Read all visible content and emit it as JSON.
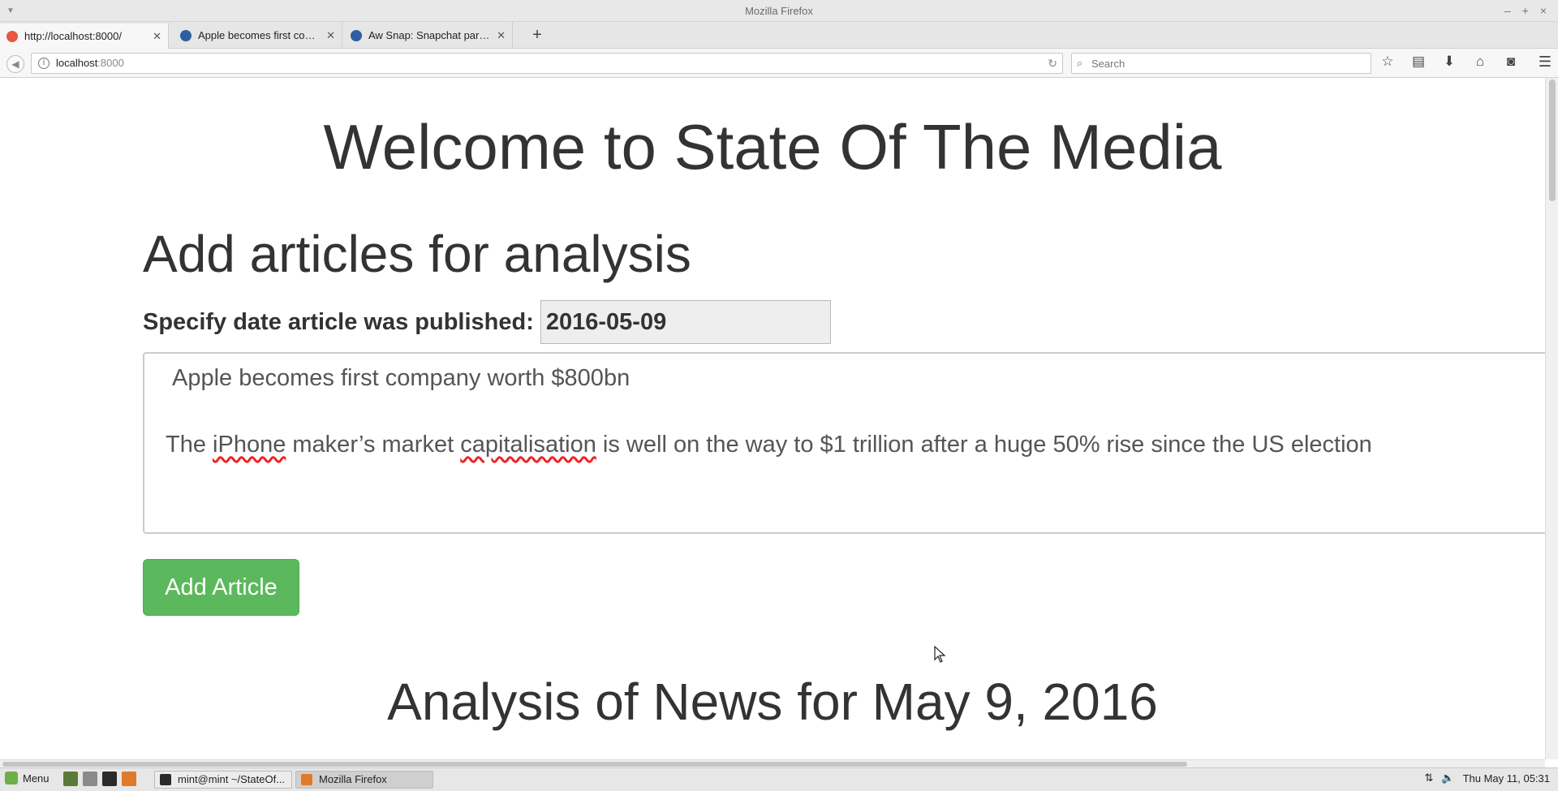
{
  "window": {
    "title": "Mozilla Firefox",
    "controls": [
      "–",
      "+",
      "×"
    ]
  },
  "tabs": [
    {
      "label": "http://localhost:8000/",
      "active": true,
      "favicon_color": "#e8573f"
    },
    {
      "label": "Apple becomes first com...",
      "active": false,
      "favicon_color": "#2f5f9e"
    },
    {
      "label": "Aw Snap: Snapchat paren...",
      "active": false,
      "favicon_color": "#2f5f9e"
    }
  ],
  "toolbar": {
    "new_tab_symbol": "+",
    "url_host": "localhost",
    "url_port": ":8000",
    "search_placeholder": "Search",
    "icons": [
      "star-icon",
      "reading-list-icon",
      "download-icon",
      "home-icon",
      "pocket-icon",
      "menu-icon"
    ]
  },
  "page": {
    "title": "Welcome to State Of The Media",
    "add_section_title": "Add articles for analysis",
    "date_label": "Specify date article was published:",
    "date_value": "2016-05-09",
    "article": {
      "headline": "Apple becomes first company worth $800bn",
      "body_part1": "The ",
      "body_spell1": "iPhone",
      "body_part2": " maker’s market ",
      "body_spell2": "capitalisation",
      "body_part3": " is well on the way to $1 trillion after a huge 50% rise since the US election"
    },
    "add_button_label": "Add Article",
    "button_color": "#5cb85c",
    "analysis_title": "Analysis of News for May 9, 2016"
  },
  "taskbar": {
    "menu_label": "Menu",
    "tasks": [
      {
        "label": "mint@mint ~/StateOf...",
        "active": false
      },
      {
        "label": "Mozilla Firefox",
        "active": true
      }
    ],
    "clock": "Thu May 11, 05:31"
  }
}
